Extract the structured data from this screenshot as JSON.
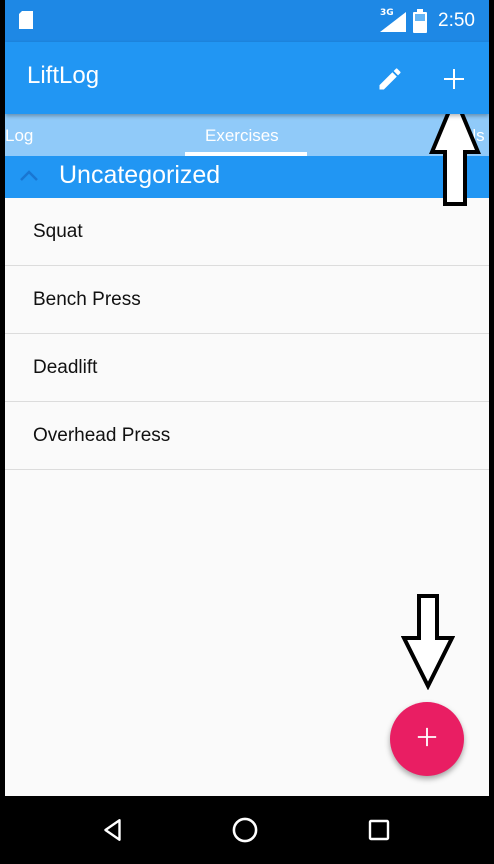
{
  "status_bar": {
    "time": "2:50",
    "network": "3G"
  },
  "toolbar": {
    "title": "LiftLog",
    "icons": [
      "edit-icon",
      "add-icon"
    ]
  },
  "tabs": [
    {
      "label": "Log"
    },
    {
      "label": "Exercises",
      "selected": true
    },
    {
      "label": "Tools"
    }
  ],
  "category": {
    "label": "Uncategorized",
    "expanded": true
  },
  "exercises": [
    {
      "name": "Squat"
    },
    {
      "name": "Bench Press"
    },
    {
      "name": "Deadlift"
    },
    {
      "name": "Overhead Press"
    }
  ],
  "fab": {
    "icon": "plus-icon"
  },
  "navigation": {
    "icons": [
      "back-icon",
      "home-icon",
      "recents-icon"
    ]
  },
  "colors": {
    "primary": "#2196f3",
    "status_bar": "#1e88e5",
    "tab_strip": "#90caf9",
    "accent": "#e91e63",
    "background": "#fafafa"
  }
}
